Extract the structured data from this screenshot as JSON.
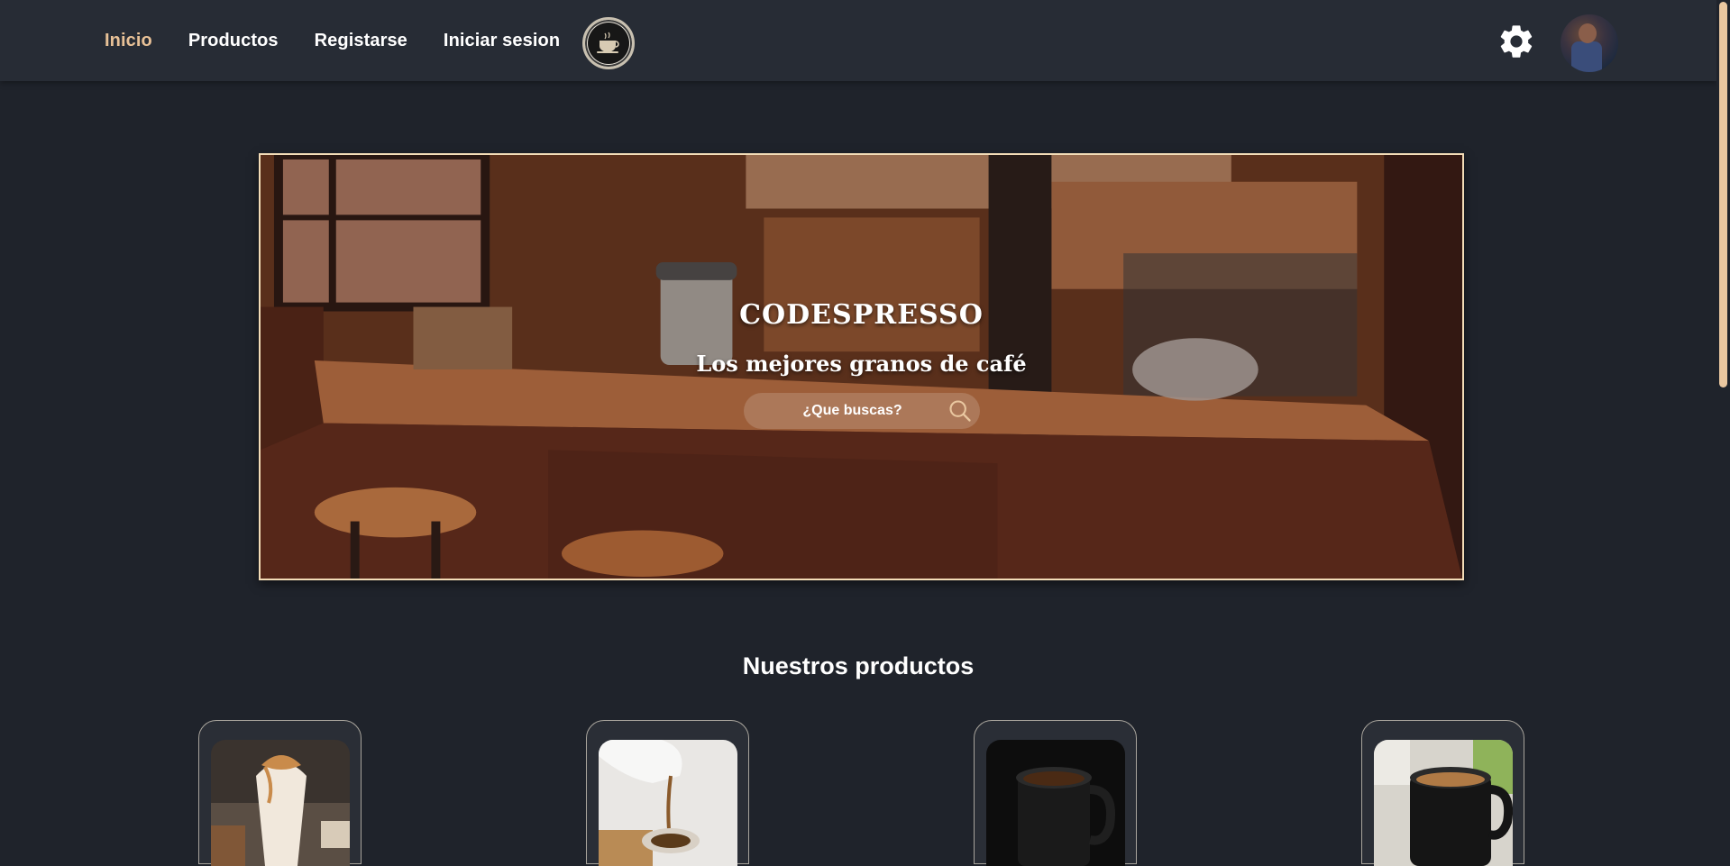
{
  "nav": {
    "links": [
      {
        "label": "Inicio",
        "active": true
      },
      {
        "label": "Productos",
        "active": false
      },
      {
        "label": "Registarse",
        "active": false
      },
      {
        "label": "Iniciar sesion",
        "active": false
      }
    ],
    "logo_icon": "coffee-cup-logo",
    "settings_icon": "gear-icon",
    "avatar_icon": "user-avatar"
  },
  "hero": {
    "title": "CODESPRESSO",
    "subtitle": "Los mejores granos de café",
    "search_placeholder": "¿Que buscas?",
    "search_icon": "search-icon"
  },
  "products": {
    "section_title": "Nuestros productos",
    "items": [
      {
        "image": "caramel-frappe-glass"
      },
      {
        "image": "pouring-milk-coffee"
      },
      {
        "image": "black-coffee-mug"
      },
      {
        "image": "coffee-mug-window"
      }
    ]
  },
  "colors": {
    "background": "#1f232b",
    "navbar": "#272c35",
    "accent": "#e8c197",
    "hero_border": "#f3dcb7"
  }
}
